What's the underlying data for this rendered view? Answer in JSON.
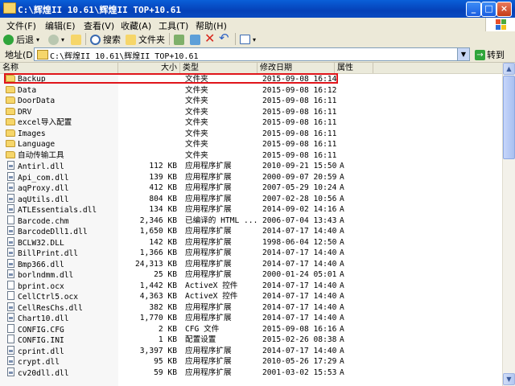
{
  "window": {
    "title": "C:\\辉煌II 10.61\\辉煌II TOP+10.61"
  },
  "title_buttons": {
    "minimize": "_",
    "maximize": "□",
    "close": "×"
  },
  "menu": [
    "文件(F)",
    "编辑(E)",
    "查看(V)",
    "收藏(A)",
    "工具(T)",
    "帮助(H)"
  ],
  "toolbar": {
    "back": "后退",
    "search": "搜索",
    "folders": "文件夹",
    "icons": [
      "back-arrow-icon",
      "forward-arrow-icon",
      "up-folder-icon",
      "search-icon",
      "folders-icon",
      "move-to-icon",
      "copy-to-icon",
      "delete-icon",
      "undo-icon",
      "views-icon"
    ]
  },
  "address": {
    "label": "地址(D)",
    "path": "C:\\辉煌II 10.61\\辉煌II TOP+10.61",
    "go": "转到"
  },
  "columns": {
    "name": "名称",
    "size": "大小",
    "type": "类型",
    "modified": "修改日期",
    "attributes": "属性"
  },
  "files": [
    {
      "name": "Backup",
      "size": "",
      "type": "文件夹",
      "date": "2015-09-08 16:14",
      "attr": "",
      "icon": "folder"
    },
    {
      "name": "Data",
      "size": "",
      "type": "文件夹",
      "date": "2015-09-08 16:12",
      "attr": "",
      "icon": "folder"
    },
    {
      "name": "DoorData",
      "size": "",
      "type": "文件夹",
      "date": "2015-09-08 16:11",
      "attr": "",
      "icon": "folder"
    },
    {
      "name": "DRV",
      "size": "",
      "type": "文件夹",
      "date": "2015-09-08 16:11",
      "attr": "",
      "icon": "folder"
    },
    {
      "name": "excel导入配置",
      "size": "",
      "type": "文件夹",
      "date": "2015-09-08 16:11",
      "attr": "",
      "icon": "folder"
    },
    {
      "name": "Images",
      "size": "",
      "type": "文件夹",
      "date": "2015-09-08 16:11",
      "attr": "",
      "icon": "folder"
    },
    {
      "name": "Language",
      "size": "",
      "type": "文件夹",
      "date": "2015-09-08 16:11",
      "attr": "",
      "icon": "folder"
    },
    {
      "name": "自动传输工具",
      "size": "",
      "type": "文件夹",
      "date": "2015-09-08 16:11",
      "attr": "",
      "icon": "folder"
    },
    {
      "name": "Antirl.dll",
      "size": "112 KB",
      "type": "应用程序扩展",
      "date": "2010-09-21 15:50",
      "attr": "A",
      "icon": "dll"
    },
    {
      "name": "Api_com.dll",
      "size": "139 KB",
      "type": "应用程序扩展",
      "date": "2000-09-07 20:59",
      "attr": "A",
      "icon": "dll"
    },
    {
      "name": "aqProxy.dll",
      "size": "412 KB",
      "type": "应用程序扩展",
      "date": "2007-05-29 10:24",
      "attr": "A",
      "icon": "dll"
    },
    {
      "name": "aqUtils.dll",
      "size": "804 KB",
      "type": "应用程序扩展",
      "date": "2007-02-28 10:56",
      "attr": "A",
      "icon": "dll"
    },
    {
      "name": "ATLEssentials.dll",
      "size": "134 KB",
      "type": "应用程序扩展",
      "date": "2014-09-02 14:16",
      "attr": "A",
      "icon": "dll"
    },
    {
      "name": "Barcode.chm",
      "size": "2,346 KB",
      "type": "已编译的 HTML ...",
      "date": "2006-07-04 13:43",
      "attr": "A",
      "icon": "chm"
    },
    {
      "name": "BarcodeDll1.dll",
      "size": "1,650 KB",
      "type": "应用程序扩展",
      "date": "2014-07-17 14:40",
      "attr": "A",
      "icon": "dll"
    },
    {
      "name": "BCLW32.DLL",
      "size": "142 KB",
      "type": "应用程序扩展",
      "date": "1998-06-04 12:50",
      "attr": "A",
      "icon": "dll"
    },
    {
      "name": "BillPrint.dll",
      "size": "1,366 KB",
      "type": "应用程序扩展",
      "date": "2014-07-17 14:40",
      "attr": "A",
      "icon": "dll"
    },
    {
      "name": "Bmp366.dll",
      "size": "24,313 KB",
      "type": "应用程序扩展",
      "date": "2014-07-17 14:40",
      "attr": "A",
      "icon": "dll"
    },
    {
      "name": "borlndmm.dll",
      "size": "25 KB",
      "type": "应用程序扩展",
      "date": "2000-01-24 05:01",
      "attr": "A",
      "icon": "dll"
    },
    {
      "name": "bprint.ocx",
      "size": "1,442 KB",
      "type": "ActiveX 控件",
      "date": "2014-07-17 14:40",
      "attr": "A",
      "icon": "ocx"
    },
    {
      "name": "CellCtrl5.ocx",
      "size": "4,363 KB",
      "type": "ActiveX 控件",
      "date": "2014-07-17 14:40",
      "attr": "A",
      "icon": "ocx"
    },
    {
      "name": "CellResChs.dll",
      "size": "382 KB",
      "type": "应用程序扩展",
      "date": "2014-07-17 14:40",
      "attr": "A",
      "icon": "dll"
    },
    {
      "name": "Chart10.dll",
      "size": "1,770 KB",
      "type": "应用程序扩展",
      "date": "2014-07-17 14:40",
      "attr": "A",
      "icon": "dll"
    },
    {
      "name": "CONFIG.CFG",
      "size": "2 KB",
      "type": "CFG 文件",
      "date": "2015-09-08 16:16",
      "attr": "A",
      "icon": "file"
    },
    {
      "name": "CONFIG.INI",
      "size": "1 KB",
      "type": "配置设置",
      "date": "2015-02-26 08:38",
      "attr": "A",
      "icon": "ini"
    },
    {
      "name": "cprint.dll",
      "size": "3,397 KB",
      "type": "应用程序扩展",
      "date": "2014-07-17 14:40",
      "attr": "A",
      "icon": "dll"
    },
    {
      "name": "crypt.dll",
      "size": "95 KB",
      "type": "应用程序扩展",
      "date": "2010-05-26 17:29",
      "attr": "A",
      "icon": "dll"
    },
    {
      "name": "cv20dll.dll",
      "size": "59 KB",
      "type": "应用程序扩展",
      "date": "2001-03-02 15:53",
      "attr": "A",
      "icon": "dll"
    }
  ]
}
